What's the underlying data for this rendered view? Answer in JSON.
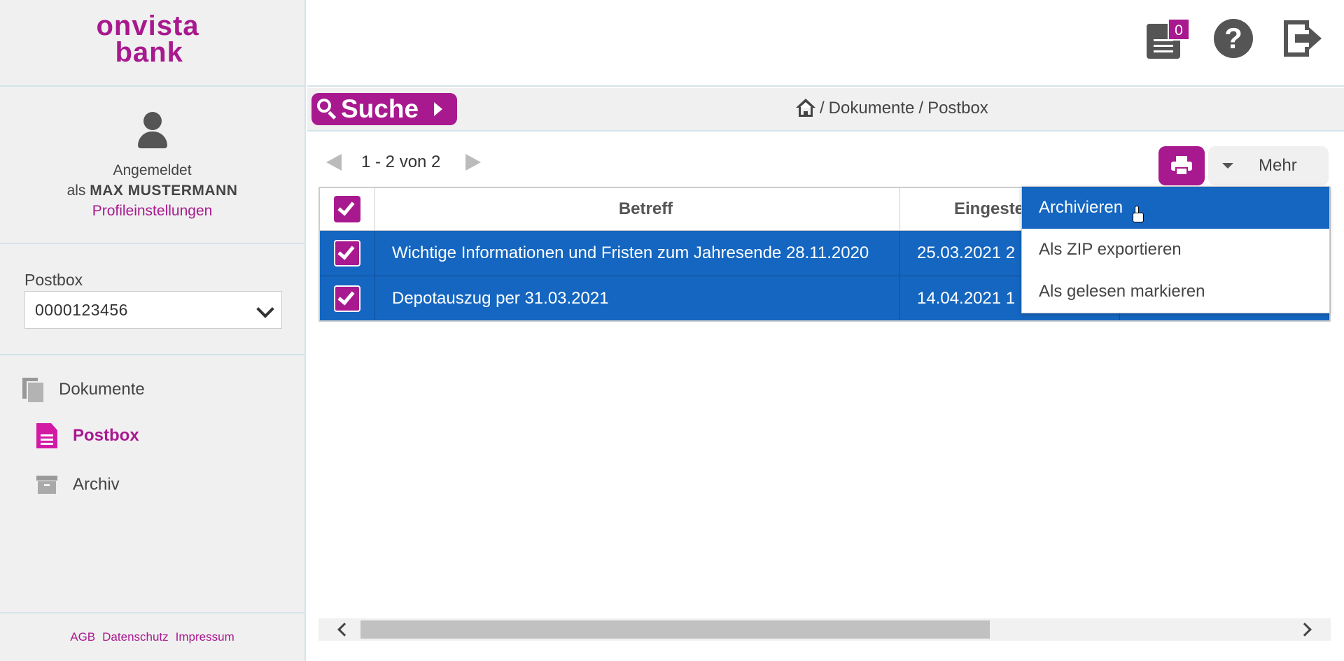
{
  "logo": {
    "line1": "onvista",
    "line2": "bank"
  },
  "user": {
    "logged_in_label": "Angemeldet",
    "as_prefix": "als",
    "name": "MAX MUSTERMANN",
    "profile_link": "Profileinstellungen"
  },
  "postbox": {
    "label": "Postbox",
    "selected": "0000123456"
  },
  "nav": {
    "documents": "Dokumente",
    "postbox": "Postbox",
    "archive": "Archiv"
  },
  "footer": {
    "agb": "AGB",
    "privacy": "Datenschutz",
    "imprint": "Impressum"
  },
  "header": {
    "messages_count": "0",
    "help_glyph": "?"
  },
  "search": {
    "label": "Suche"
  },
  "breadcrumb": {
    "separator": "/",
    "part1": "Dokumente",
    "part2": "Postbox"
  },
  "pager": {
    "text": "1 - 2 von 2"
  },
  "actions": {
    "more_label": "Mehr"
  },
  "table": {
    "headers": {
      "subject": "Betreff",
      "date": "Eingeste"
    },
    "rows": [
      {
        "subject": "Wichtige Informationen und Fristen zum Jahresende 28.11.2020",
        "date": "25.03.2021 2",
        "selected": true
      },
      {
        "subject": "Depotauszug per 31.03.2021",
        "date": "14.04.2021 1",
        "selected": true
      }
    ]
  },
  "menu": {
    "items": [
      "Archivieren",
      "Als ZIP exportieren",
      "Als gelesen markieren"
    ]
  },
  "colors": {
    "brand": "#a8198f",
    "selection": "#1466c0",
    "sidebar_bg": "#f0f0f0"
  }
}
